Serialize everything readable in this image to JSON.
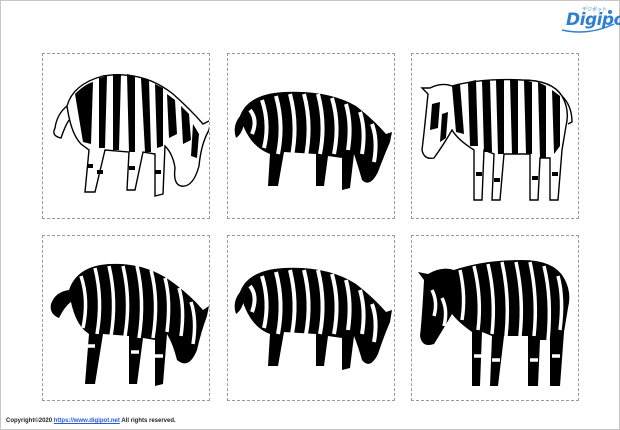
{
  "logo": {
    "text": "Digipot",
    "subtext": "デジポット",
    "brand_color": "#2f7fcf"
  },
  "cards": [
    {
      "name": "zebra-illustration-1",
      "variant": "outline-grazing-tail-left"
    },
    {
      "name": "zebra-illustration-2",
      "variant": "solid-grazing-right"
    },
    {
      "name": "zebra-illustration-3",
      "variant": "outline-standing-left"
    },
    {
      "name": "zebra-illustration-4",
      "variant": "solid-grazing-tail-left"
    },
    {
      "name": "zebra-illustration-5",
      "variant": "solid-grazing-right"
    },
    {
      "name": "zebra-illustration-6",
      "variant": "solid-standing-left"
    }
  ],
  "footer": {
    "prefix": "Copyright©2020 ",
    "link": "https://www.digipot.net",
    "suffix": " All rights reserved."
  },
  "colors": {
    "stripe": "#000000",
    "background": "#ffffff",
    "card_border": "#9a9a9a",
    "link": "#2a5bd7"
  }
}
